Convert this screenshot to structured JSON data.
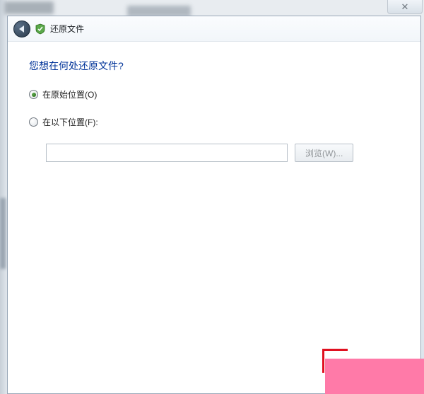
{
  "window": {
    "title": "还原文件"
  },
  "dialog": {
    "heading": "您想在何处还原文件?",
    "options": {
      "original": {
        "label": "在原始位置(O)",
        "checked": true
      },
      "following": {
        "label": "在以下位置(F):",
        "checked": false
      }
    },
    "path_value": "",
    "browse_label": "浏览(W)..."
  }
}
